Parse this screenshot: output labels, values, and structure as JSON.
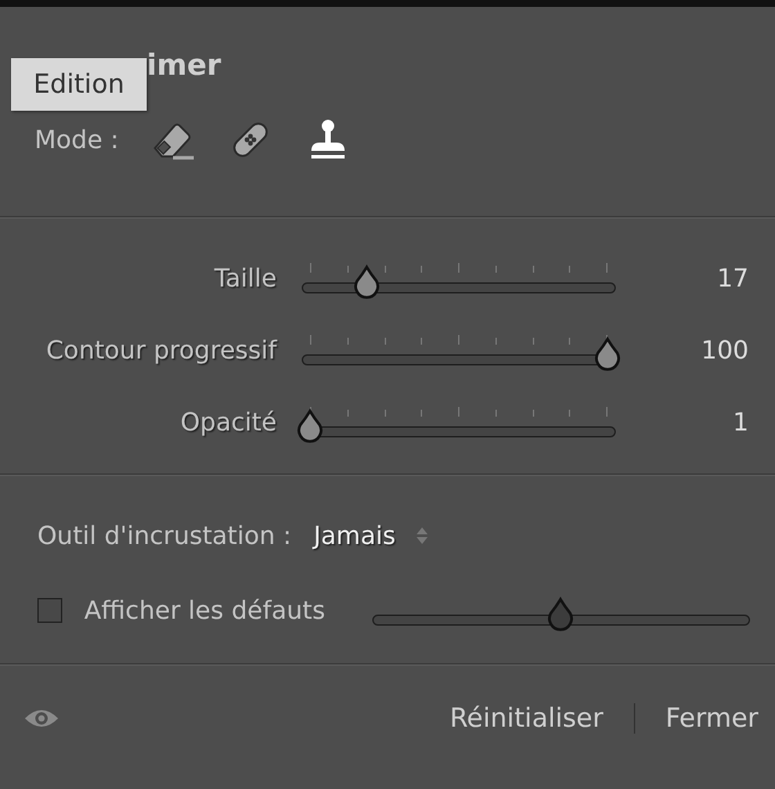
{
  "tooltip": "Edition",
  "title": "imer",
  "mode": {
    "label": "Mode :",
    "options": [
      {
        "kind": "eraser",
        "selected": false
      },
      {
        "kind": "bandage",
        "selected": false
      },
      {
        "kind": "stamp",
        "selected": true
      }
    ]
  },
  "sliders": [
    {
      "label": "Taille",
      "level": 0.19,
      "value": "17"
    },
    {
      "label": "Contour progressif",
      "level": 1,
      "value": "100"
    },
    {
      "label": "Opacité",
      "level": 0,
      "value": "1"
    }
  ],
  "overlay": {
    "label": "Outil d'incrustation :",
    "value": "Jamais"
  },
  "show_defects": {
    "label": "Afficher les défauts",
    "checked": false,
    "level": 0.5
  },
  "footer": {
    "reset": "Réinitialiser",
    "close": "Fermer"
  }
}
